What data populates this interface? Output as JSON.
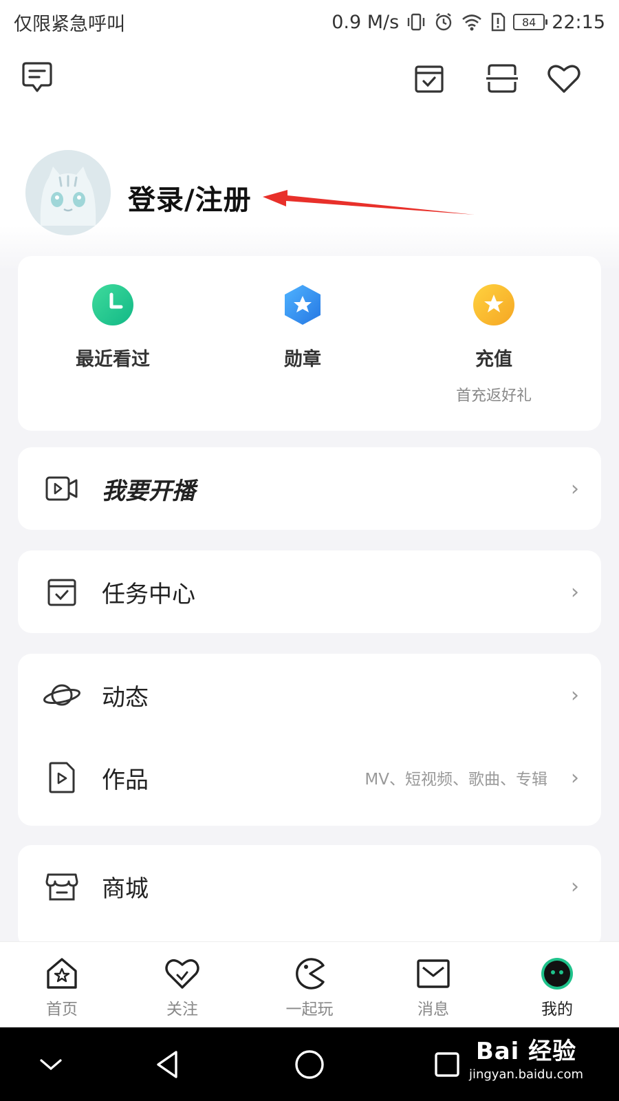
{
  "status_bar": {
    "carrier": "仅限紧急呼叫",
    "speed": "0.9 M/s",
    "battery": "84",
    "time": "22:15"
  },
  "toolbar": {
    "icons": [
      "message-icon",
      "checkin-calendar-icon",
      "scan-icon",
      "favorite-heart-icon"
    ]
  },
  "profile": {
    "login_label": "登录/注册"
  },
  "quick_actions": [
    {
      "label": "最近看过",
      "sub": "",
      "icon": "clock-icon",
      "color": "#20c997"
    },
    {
      "label": "勋章",
      "sub": "",
      "icon": "medal-hexagon-icon",
      "color": "#2e8ef0"
    },
    {
      "label": "充值",
      "sub": "首充返好礼",
      "icon": "star-coin-icon",
      "color": "#f5a623"
    }
  ],
  "menu": {
    "live": {
      "label": "我要开播",
      "icon": "video-camera-icon"
    },
    "tasks": {
      "label": "任务中心",
      "icon": "task-calendar-icon"
    },
    "feed": {
      "label": "动态",
      "icon": "planet-icon"
    },
    "works": {
      "label": "作品",
      "hint": "MV、短视频、歌曲、专辑",
      "icon": "video-file-icon"
    },
    "mall": {
      "label": "商城",
      "icon": "store-icon"
    }
  },
  "bottom_nav": [
    {
      "label": "首页",
      "icon": "home-icon",
      "active": false
    },
    {
      "label": "关注",
      "icon": "heart-icon",
      "active": false
    },
    {
      "label": "一起玩",
      "icon": "pacman-icon",
      "active": false
    },
    {
      "label": "消息",
      "icon": "mail-icon",
      "active": false
    },
    {
      "label": "我的",
      "icon": "my-avatar-icon",
      "active": true
    }
  ],
  "watermark": {
    "logo": "Bai 经验",
    "url": "jingyan.baidu.com"
  },
  "colors": {
    "accent_green": "#20c997",
    "annotation_red": "#e8302a"
  }
}
